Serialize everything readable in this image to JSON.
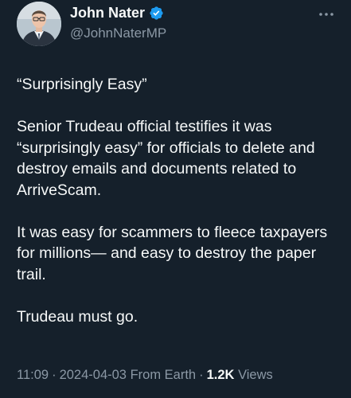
{
  "author": {
    "display_name": "John Nater",
    "handle": "@JohnNaterMP",
    "verified": true
  },
  "tweet": {
    "paragraphs": [
      "“Surprisingly Easy”",
      "Senior Trudeau official testifies it was “surprisingly easy” for officials to delete and destroy emails and documents related to ArriveScam.",
      "It was easy for scammers to fleece taxpayers for millions— and easy to destroy the paper trail.",
      "Trudeau must go."
    ]
  },
  "meta": {
    "time": "11:09",
    "date": "2024-04-03",
    "source": "From Earth",
    "separator": "·",
    "views_count": "1.2K",
    "views_label": "Views"
  },
  "icons": {
    "verified": "verified-badge-icon",
    "more": "more-horizontal-icon"
  },
  "colors": {
    "background": "#15202b",
    "text_primary": "#f7f9f9",
    "text_secondary": "#8b98a5",
    "verified_blue": "#1d9bf0"
  }
}
